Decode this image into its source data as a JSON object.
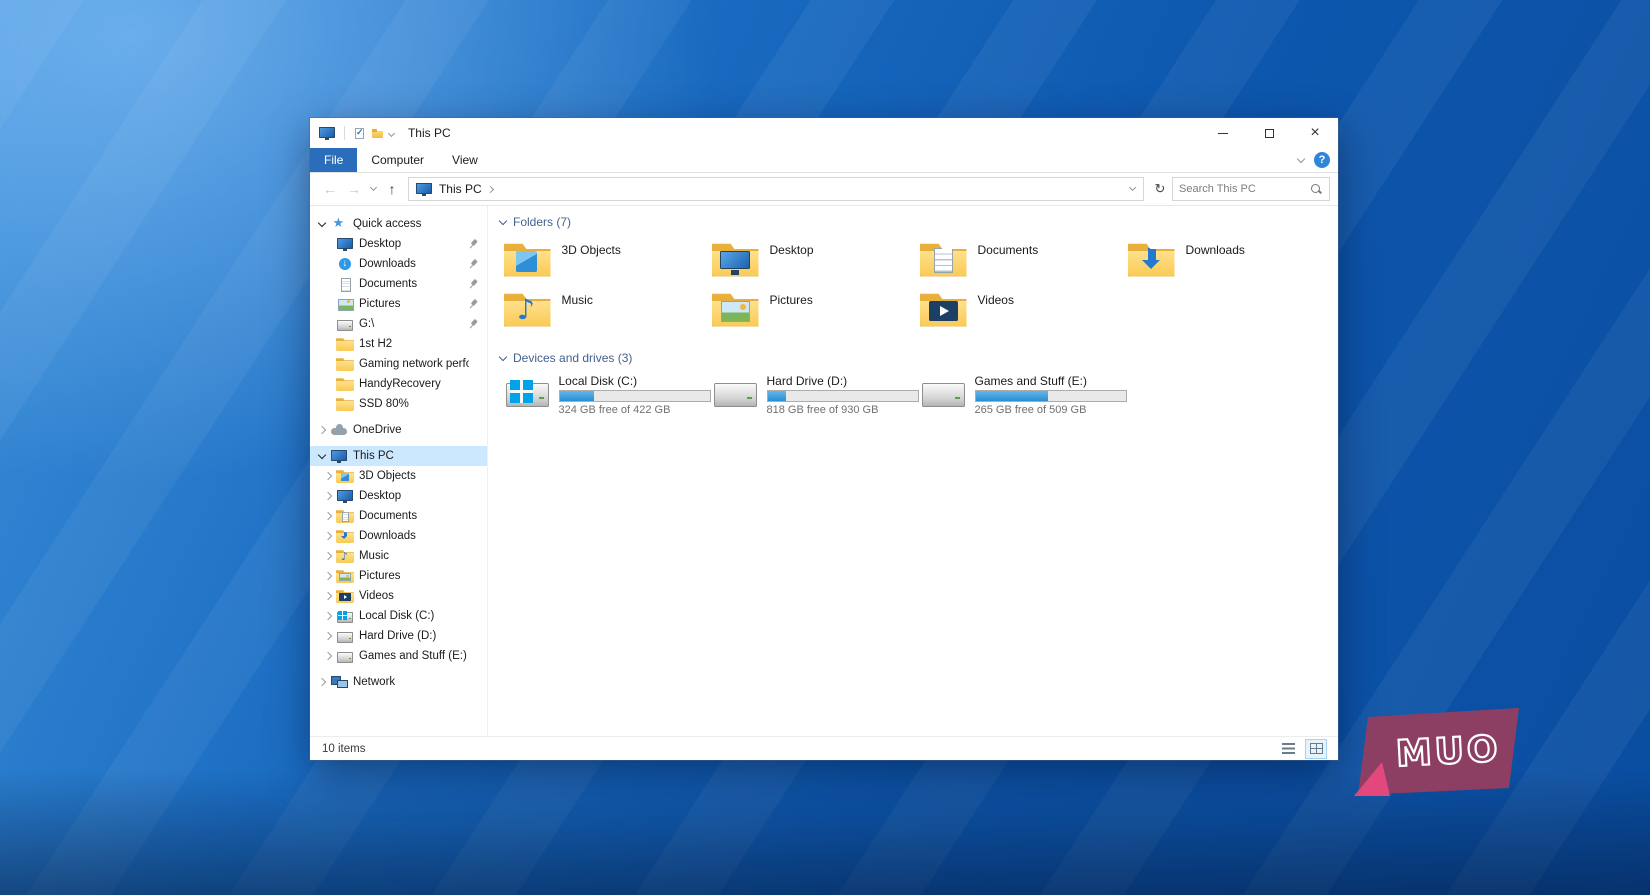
{
  "window": {
    "title": "This PC"
  },
  "ribbon": {
    "tabs": [
      {
        "label": "File",
        "active": true
      },
      {
        "label": "Computer"
      },
      {
        "label": "View"
      }
    ],
    "help_label": "?"
  },
  "address": {
    "location": "This PC",
    "search_placeholder": "Search This PC"
  },
  "sidebar": {
    "quick_access": {
      "label": "Quick access",
      "items": [
        {
          "label": "Desktop",
          "icon": "pc",
          "pinned": true
        },
        {
          "label": "Downloads",
          "icon": "dl-badge",
          "pinned": true
        },
        {
          "label": "Documents",
          "icon": "page",
          "pinned": true
        },
        {
          "label": "Pictures",
          "icon": "photo",
          "pinned": true
        },
        {
          "label": "G:\\",
          "icon": "drive",
          "pinned": true
        },
        {
          "label": "1st H2",
          "icon": "folder",
          "pinned": false
        },
        {
          "label": "Gaming network performance",
          "icon": "folder",
          "pinned": false
        },
        {
          "label": "HandyRecovery",
          "icon": "folder",
          "pinned": false
        },
        {
          "label": "SSD 80%",
          "icon": "folder",
          "pinned": false
        }
      ]
    },
    "onedrive": {
      "label": "OneDrive",
      "icon": "cloud"
    },
    "this_pc": {
      "label": "This PC",
      "icon": "pc",
      "items": [
        {
          "label": "3D Objects",
          "icon": "3d"
        },
        {
          "label": "Desktop",
          "icon": "pc"
        },
        {
          "label": "Documents",
          "icon": "documents"
        },
        {
          "label": "Downloads",
          "icon": "downloads"
        },
        {
          "label": "Music",
          "icon": "music"
        },
        {
          "label": "Pictures",
          "icon": "pictures"
        },
        {
          "label": "Videos",
          "icon": "videos"
        },
        {
          "label": "Local Disk (C:)",
          "icon": "drive-win"
        },
        {
          "label": "Hard Drive (D:)",
          "icon": "drive"
        },
        {
          "label": "Games and Stuff (E:)",
          "icon": "drive"
        }
      ]
    },
    "network": {
      "label": "Network",
      "icon": "network"
    }
  },
  "main": {
    "folders": {
      "label": "Folders (7)",
      "items": [
        {
          "name": "3D Objects",
          "icon": "3d"
        },
        {
          "name": "Desktop",
          "icon": "desktop"
        },
        {
          "name": "Documents",
          "icon": "documents"
        },
        {
          "name": "Downloads",
          "icon": "downloads"
        },
        {
          "name": "Music",
          "icon": "music"
        },
        {
          "name": "Pictures",
          "icon": "pictures"
        },
        {
          "name": "Videos",
          "icon": "videos"
        }
      ]
    },
    "drives": {
      "label": "Devices and drives (3)",
      "items": [
        {
          "name": "Local Disk (C:)",
          "icon": "drive-win",
          "free_text": "324 GB free of 422 GB",
          "used_width": "23%"
        },
        {
          "name": "Hard Drive (D:)",
          "icon": "drive",
          "free_text": "818 GB free of 930 GB",
          "used_width": "12%"
        },
        {
          "name": "Games and Stuff (E:)",
          "icon": "drive",
          "free_text": "265 GB free of 509 GB",
          "used_width": "48%"
        }
      ]
    }
  },
  "statusbar": {
    "items_text": "10 items"
  },
  "watermark": {
    "text": "MUO"
  },
  "colors": {
    "accent_blue": "#2a6ebb",
    "selection_blue": "#cce8ff",
    "progress_blue": "#2a8dd4",
    "watermark_maroon": "#8c3f63",
    "watermark_pink": "#e2487c"
  }
}
